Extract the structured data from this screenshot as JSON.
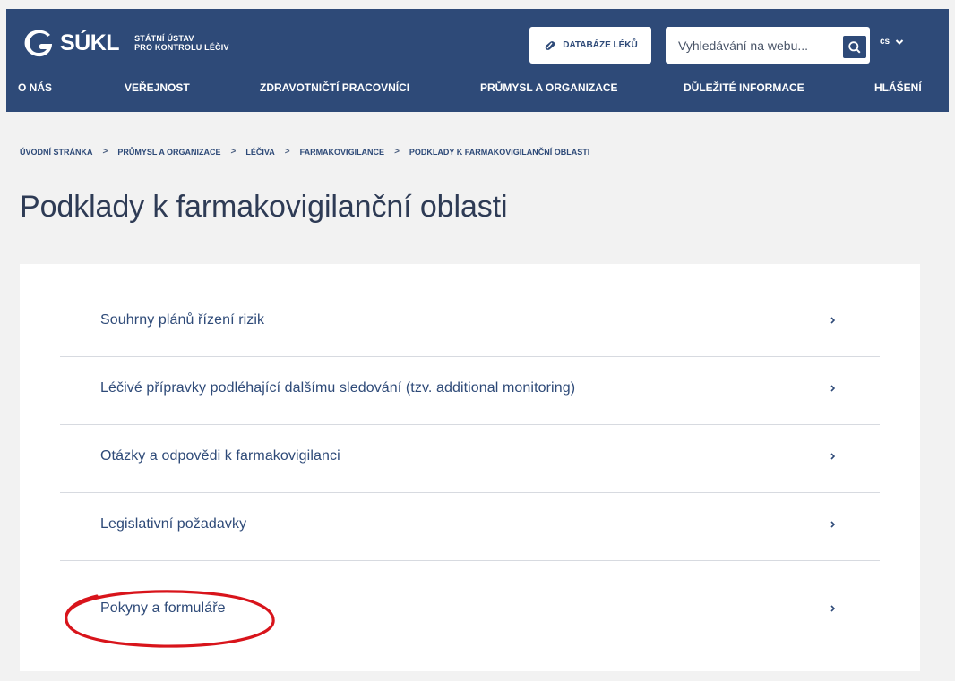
{
  "header": {
    "logo_text": "SÚKL",
    "subtitle_line1": "STÁTNÍ ÚSTAV",
    "subtitle_line2": "PRO KONTROLU LÉČIV",
    "database_button": "DATABÁZE LÉKŮ",
    "search": {
      "placeholder": "Vyhledávání na webu..."
    },
    "language": "cs",
    "nav": [
      {
        "label": "O NÁS"
      },
      {
        "label": "VEŘEJNOST"
      },
      {
        "label": "ZDRAVOTNIČTÍ PRACOVNÍCI"
      },
      {
        "label": "PRŮMYSL A ORGANIZACE"
      },
      {
        "label": "DŮLEŽITÉ INFORMACE"
      },
      {
        "label": "HLÁŠENÍ"
      }
    ]
  },
  "breadcrumb": [
    {
      "label": "ÚVODNÍ STRÁNKA"
    },
    {
      "label": "PRŮMYSL A ORGANIZACE"
    },
    {
      "label": "LÉČIVA"
    },
    {
      "label": "FARMAKOVIGILANCE"
    },
    {
      "label": "PODKLADY K FARMAKOVIGILANČNÍ OBLASTI"
    }
  ],
  "breadcrumb_separator": ">",
  "page_title": "Podklady k farmakovigilanční oblasti",
  "links": [
    {
      "label": "Souhrny plánů řízení rizik"
    },
    {
      "label": "Léčivé přípravky podléhající dalšímu sledování (tzv. additional monitoring)"
    },
    {
      "label": "Otázky a odpovědi k farmakovigilanci"
    },
    {
      "label": "Legislativní požadavky"
    },
    {
      "label": "Pokyny a formuláře"
    }
  ],
  "colors": {
    "header_bg": "#2e4a78",
    "page_bg": "#f2f2f2",
    "link_text": "#2e4a78",
    "annotation_red": "#d8141b"
  }
}
